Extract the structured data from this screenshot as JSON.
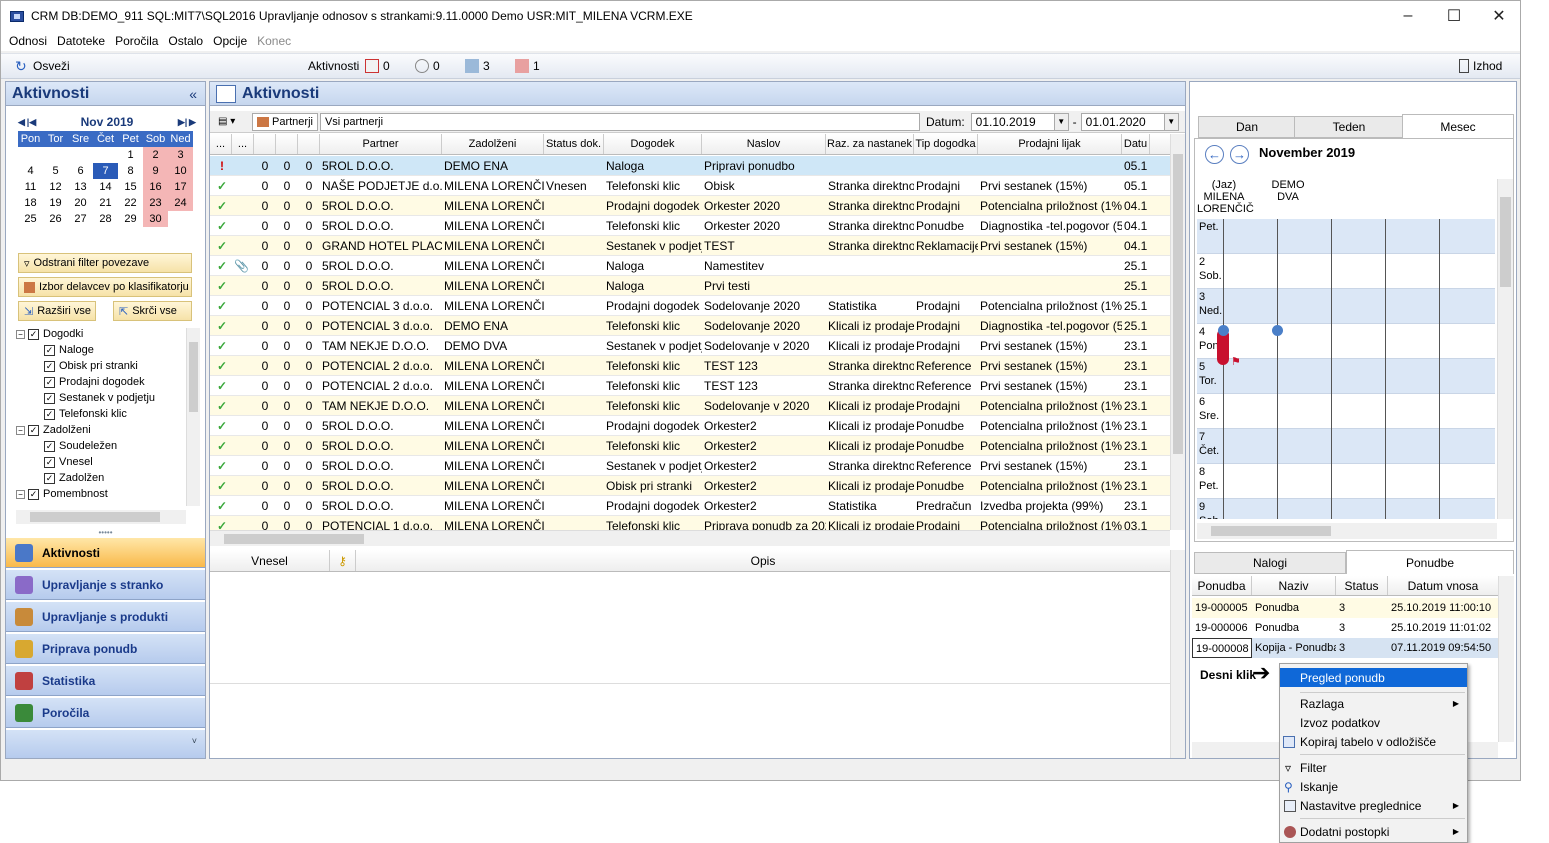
{
  "window": {
    "title": "CRM   DB:DEMO_911   SQL:MIT7\\SQL2016   Upravljanje odnosov s strankami:9.11.0000   Demo   USR:MIT_MILENA   VCRM.EXE"
  },
  "menu": [
    "Odnosi",
    "Datoteke",
    "Poročila",
    "Ostalo",
    "Opcije",
    "Konec"
  ],
  "toolbar": {
    "refresh": "Osveži",
    "activities": "Aktivnosti",
    "c1": "0",
    "c2": "0",
    "c3": "3",
    "c4": "1",
    "exit": "Izhod"
  },
  "left": {
    "title": "Aktivnosti",
    "collapse": "«",
    "calendar": {
      "month": "Nov 2019",
      "days": [
        "Pon",
        "Tor",
        "Sre",
        "Čet",
        "Pet",
        "Sob",
        "Ned"
      ],
      "weeks": [
        [
          "",
          "",
          "",
          "",
          "1",
          "2",
          "3"
        ],
        [
          "4",
          "5",
          "6",
          "7",
          "8",
          "9",
          "10"
        ],
        [
          "11",
          "12",
          "13",
          "14",
          "15",
          "16",
          "17"
        ],
        [
          "18",
          "19",
          "20",
          "21",
          "22",
          "23",
          "24"
        ],
        [
          "25",
          "26",
          "27",
          "28",
          "29",
          "30",
          ""
        ]
      ]
    },
    "btn_filter": "Odstrani filter povezave",
    "btn_workers": "Izbor delavcev po klasifikatorju",
    "btn_expand": "Razširi vse",
    "btn_collapse": "Skrči vse",
    "tree": [
      {
        "label": "Dogodki",
        "lvl": 0
      },
      {
        "label": "Naloge",
        "lvl": 1
      },
      {
        "label": "Obisk pri stranki",
        "lvl": 1
      },
      {
        "label": "Prodajni dogodek",
        "lvl": 1
      },
      {
        "label": "Sestanek v podjetju",
        "lvl": 1
      },
      {
        "label": "Telefonski klic",
        "lvl": 1
      },
      {
        "label": "Zadolženi",
        "lvl": 0
      },
      {
        "label": "Soudeležen",
        "lvl": 1
      },
      {
        "label": "Vnesel",
        "lvl": 1
      },
      {
        "label": "Zadolžen",
        "lvl": 1
      },
      {
        "label": "Pomembnost",
        "lvl": 0
      }
    ],
    "nav": [
      "Aktivnosti",
      "Upravljanje s stranko",
      "Upravljanje s produkti",
      "Priprava ponudb",
      "Statistika",
      "Poročila"
    ]
  },
  "center": {
    "title": "Aktivnosti",
    "partners_btn": "Partnerji",
    "partners_value": "Vsi partnerji",
    "date_label": "Datum:",
    "date_from": "01.10.2019",
    "date_sep": "-",
    "date_to": "01.01.2020",
    "columns": [
      "...",
      "...",
      "",
      "",
      "",
      "Partner",
      "Zadolženi",
      "Status dok.",
      "Dogodek",
      "Naslov",
      "Raz. za nastanek",
      "Tip dogodka",
      "Prodajni lijak",
      "Datu"
    ],
    "rows": [
      [
        "!",
        "",
        "0",
        "0",
        "0",
        "5ROL D.O.O.",
        "DEMO ENA",
        "",
        "Naloga",
        "Pripravi ponudbo",
        "",
        "",
        "",
        "05.1"
      ],
      [
        "✓",
        "",
        "0",
        "0",
        "0",
        "NAŠE PODJETJE d.o.o.",
        "MILENA LORENČIČ",
        "Vnesen",
        "Telefonski klic",
        "Obisk",
        "Stranka direktno",
        "Prodajni",
        "Prvi sestanek (15%)",
        "05.1"
      ],
      [
        "✓",
        "",
        "0",
        "0",
        "0",
        "5ROL D.O.O.",
        "MILENA LORENČIČ",
        "",
        "Prodajni dogodek",
        "Orkester 2020",
        "Stranka direktno",
        "Prodajni",
        "Potencialna priložnost (1%)",
        "04.1"
      ],
      [
        "✓",
        "",
        "0",
        "0",
        "0",
        "5ROL D.O.O.",
        "MILENA LORENČIČ",
        "",
        "Telefonski klic",
        "Orkester 2020",
        "Stranka direktno",
        "Ponudbe",
        "Diagnostika -tel.pogovor (5%)",
        "04.1"
      ],
      [
        "✓",
        "",
        "0",
        "0",
        "0",
        "GRAND HOTEL PLACE",
        "MILENA LORENČIČ",
        "",
        "Sestanek v podjetju",
        "TEST",
        "Stranka direktno",
        "Reklamacije",
        "Prvi sestanek (15%)",
        "04.1"
      ],
      [
        "✓",
        "📎",
        "0",
        "0",
        "0",
        "5ROL D.O.O.",
        "MILENA LORENČIČ",
        "",
        "Naloga",
        "Namestitev",
        "",
        "",
        "",
        "25.1"
      ],
      [
        "✓",
        "",
        "0",
        "0",
        "0",
        "5ROL D.O.O.",
        "MILENA LORENČIČ",
        "",
        "Naloga",
        "Prvi testi",
        "",
        "",
        "",
        "25.1"
      ],
      [
        "✓",
        "",
        "0",
        "0",
        "0",
        "POTENCIAL 3 d.o.o.",
        "MILENA LORENČIČ",
        "",
        "Prodajni dogodek",
        "Sodelovanje 2020",
        "Statistika",
        "Prodajni",
        "Potencialna priložnost (1%)",
        "25.1"
      ],
      [
        "✓",
        "",
        "0",
        "0",
        "0",
        "POTENCIAL 3 d.o.o.",
        "DEMO ENA",
        "",
        "Telefonski klic",
        "Sodelovanje 2020",
        "Klicali iz prodaje",
        "Prodajni",
        "Diagnostika -tel.pogovor (5%)",
        "25.1"
      ],
      [
        "✓",
        "",
        "0",
        "0",
        "0",
        "TAM NEKJE D.O.O.",
        "DEMO DVA",
        "",
        "Sestanek v podjetju",
        "Sodelovanje v 2020",
        "Klicali iz prodaje",
        "Prodajni",
        "Prvi sestanek (15%)",
        "23.1"
      ],
      [
        "✓",
        "",
        "0",
        "0",
        "0",
        "POTENCIAL 2 d.o.o.",
        "MILENA LORENČIČ",
        "",
        "Telefonski klic",
        "TEST 123",
        "Stranka direktno",
        "Reference",
        "Prvi sestanek (15%)",
        "23.1"
      ],
      [
        "✓",
        "",
        "0",
        "0",
        "0",
        "POTENCIAL 2 d.o.o.",
        "MILENA LORENČIČ",
        "",
        "Telefonski klic",
        "TEST 123",
        "Stranka direktno",
        "Reference",
        "Prvi sestanek (15%)",
        "23.1"
      ],
      [
        "✓",
        "",
        "0",
        "0",
        "0",
        "TAM NEKJE D.O.O.",
        "MILENA LORENČIČ",
        "",
        "Telefonski klic",
        "Sodelovanje v 2020",
        "Klicali iz prodaje",
        "Prodajni",
        "Potencialna priložnost (1%)",
        "23.1"
      ],
      [
        "✓",
        "",
        "0",
        "0",
        "0",
        "5ROL D.O.O.",
        "MILENA LORENČIČ",
        "",
        "Prodajni dogodek",
        "Orkester2",
        "Klicali iz prodaje",
        "Ponudbe",
        "Potencialna priložnost (1%)",
        "23.1"
      ],
      [
        "✓",
        "",
        "0",
        "0",
        "0",
        "5ROL D.O.O.",
        "MILENA LORENČIČ",
        "",
        "Telefonski klic",
        "Orkester2",
        "Klicali iz prodaje",
        "Ponudbe",
        "Potencialna priložnost (1%)",
        "23.1"
      ],
      [
        "✓",
        "",
        "0",
        "0",
        "0",
        "5ROL D.O.O.",
        "MILENA LORENČIČ",
        "",
        "Sestanek v podjetju",
        "Orkester2",
        "Stranka direktno",
        "Reference",
        "Prvi sestanek (15%)",
        "23.1"
      ],
      [
        "✓",
        "",
        "0",
        "0",
        "0",
        "5ROL D.O.O.",
        "MILENA LORENČIČ",
        "",
        "Obisk pri stranki",
        "Orkester2",
        "Klicali iz prodaje",
        "Ponudbe",
        "Potencialna priložnost (1%)",
        "23.1"
      ],
      [
        "✓",
        "",
        "0",
        "0",
        "0",
        "5ROL D.O.O.",
        "MILENA LORENČIČ",
        "",
        "Prodajni dogodek",
        "Orkester2",
        "Statistika",
        "Predračun",
        "Izvedba projekta (99%)",
        "23.1"
      ],
      [
        "✓",
        "",
        "0",
        "0",
        "0",
        "POTENCIAL 1 d.o.o.",
        "MILENA LORENČIČ",
        "",
        "Telefonski klic",
        "Priprava ponudb za 2020",
        "Klicali iz prodaje",
        "Prodajni",
        "Potencialna priložnost (1%)",
        "03.1"
      ]
    ],
    "detail_cols": [
      "Vnesel",
      "",
      "Opis"
    ]
  },
  "right": {
    "tabs": [
      "Dan",
      "Teden",
      "Mesec"
    ],
    "month": "November 2019",
    "people": [
      "(Jaz)\nMILENA\nLORENČIČ",
      "DEMO\nDVA"
    ],
    "days": [
      [
        "",
        "Pet."
      ],
      [
        "2",
        "Sob."
      ],
      [
        "3",
        "Ned."
      ],
      [
        "4",
        "Pon."
      ],
      [
        "5",
        "Tor."
      ],
      [
        "6",
        "Sre."
      ],
      [
        "7",
        "Čet."
      ],
      [
        "8",
        "Pet."
      ],
      [
        "9",
        "Sob."
      ]
    ],
    "tabs2": [
      "Nalogi",
      "Ponudbe"
    ],
    "offer_cols": [
      "Ponudba",
      "Naziv",
      "Status",
      "Datum vnosa"
    ],
    "offers": [
      [
        "19-000005",
        "Ponudba",
        "3",
        "25.10.2019 11:00:10"
      ],
      [
        "19-000006",
        "Ponudba",
        "3",
        "25.10.2019 11:01:02"
      ],
      [
        "19-000008",
        "Kopija - Ponudba",
        "3",
        "07.11.2019 09:54:50"
      ]
    ],
    "hint": "Desni klik"
  },
  "context_menu": [
    "Pregled ponudb",
    "Razlaga",
    "Izvoz podatkov",
    "Kopiraj tabelo v odložišče",
    "Filter",
    "Iskanje",
    "Nastavitve preglednice",
    "Dodatni postopki"
  ]
}
